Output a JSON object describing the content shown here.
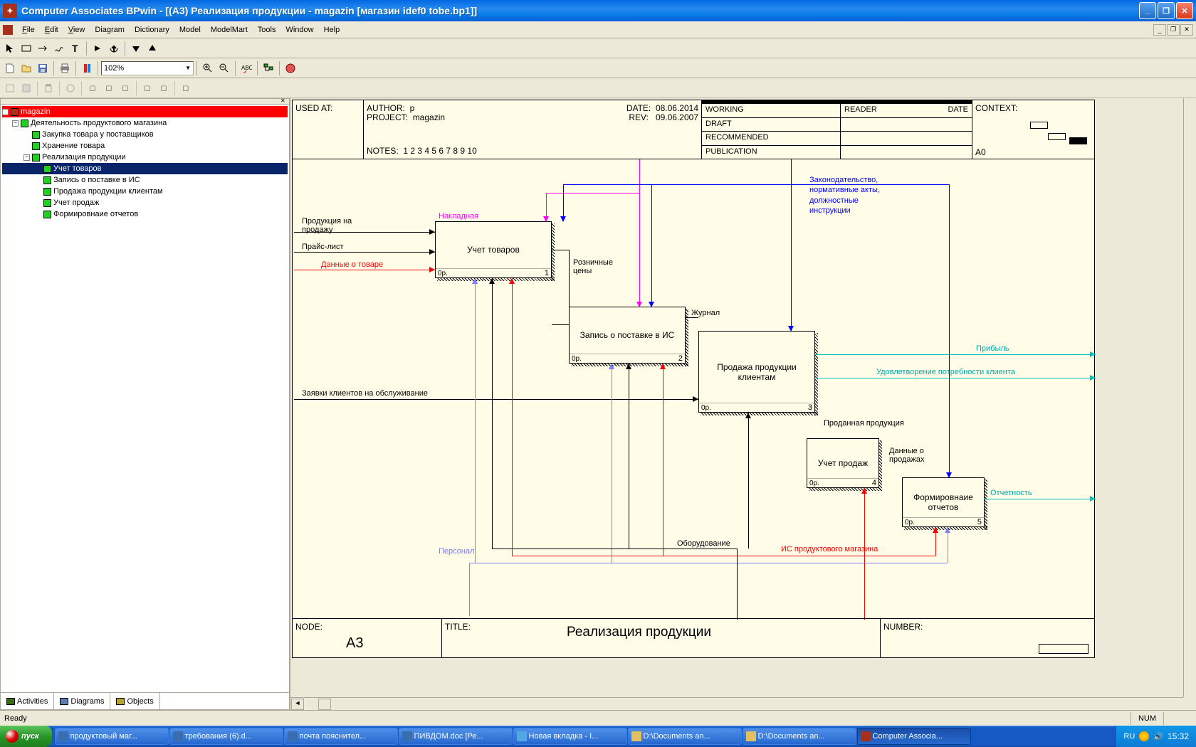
{
  "window": {
    "title": "Computer Associates BPwin - [(A3) Реализация   продукции - magazin  [магазин idef0 tobe.bp1]]"
  },
  "menu": {
    "file": "File",
    "edit": "Edit",
    "view": "View",
    "diagram": "Diagram",
    "dictionary": "Dictionary",
    "model": "Model",
    "modelmart": "ModelMart",
    "tools": "Tools",
    "window": "Window",
    "help": "Help"
  },
  "toolbar2": {
    "zoom": "102%"
  },
  "tree": {
    "root": "magazin",
    "n0": "Деятельность продуктового магазина",
    "n1": "Закупка товара  у поставщиков",
    "n2": "Хранение товара",
    "n3": "Реализация  продукции",
    "n3_1": "Учет товаров",
    "n3_2": "Запись о поставке в ИС",
    "n3_3": "Продажа продукции клиентам",
    "n3_4": "Учет продаж",
    "n3_5": "Формировнаие отчетов"
  },
  "explorer_tabs": {
    "activities": "Activities",
    "diagrams": "Diagrams",
    "objects": "Objects"
  },
  "header": {
    "used_at": "USED AT:",
    "author_lbl": "AUTHOR:",
    "author_val": "p",
    "project_lbl": "PROJECT:",
    "project_val": "magazin",
    "date_lbl": "DATE:",
    "date_val": "08.06.2014",
    "rev_lbl": "REV:",
    "rev_val": "09.06.2007",
    "notes_lbl": "NOTES:",
    "notes_val": "1  2  3  4  5  6  7  8  9  10",
    "working": "WORKING",
    "draft": "DRAFT",
    "recommended": "RECOMMENDED",
    "publication": "PUBLICATION",
    "reader": "READER",
    "reader_date": "DATE",
    "context": "CONTEXT:",
    "context_sub": "A0"
  },
  "footer": {
    "node_lbl": "NODE:",
    "node_val": "A3",
    "title_lbl": "TITLE:",
    "title_val": "Реализация   продукции",
    "number_lbl": "NUMBER:"
  },
  "boxes": {
    "b1": {
      "title": "Учет товаров",
      "op": "0р.",
      "num": "1"
    },
    "b2": {
      "title": "Запись о поставке в ИС",
      "op": "0р.",
      "num": "2"
    },
    "b3": {
      "title": "Продажа продукции клиентам",
      "op": "0р.",
      "num": "3"
    },
    "b4": {
      "title": "Учет продаж",
      "op": "0р.",
      "num": "4"
    },
    "b5": {
      "title": "Формировнаие отчетов",
      "op": "0р.",
      "num": "5"
    }
  },
  "arrows": {
    "a1": "Продукция на продажу",
    "a2": "Прайс-лист",
    "a3": "Данные о товаре",
    "a4": "Накладная",
    "a5": "Розничные цены",
    "a6": "Журнал",
    "a7": "Заявки клиентов на обслуживание",
    "a8": "Прибыль",
    "a9": "Удовлетворение потребности клиента",
    "a10": "Проданная продукция",
    "a11": "Данные о продажах",
    "a12": "Отчетность",
    "a13": "Персонал",
    "a14": "Оборудование",
    "a15": "ИС продуктового магазина",
    "a16_l1": "Законодательство,",
    "a16_l2": "нормативные акты,",
    "a16_l3": "должностные",
    "a16_l4": "инструкции"
  },
  "status": {
    "ready": "Ready",
    "num": "NUM"
  },
  "taskbar": {
    "start": "пуск",
    "lang": "RU",
    "time": "15:32",
    "items": [
      "продуктовый маг...",
      "требования (6).d...",
      "почта пояснител...",
      "ПИВДОМ.doc [Ре...",
      "Новая вкладка - I...",
      "D:\\Documents an...",
      "D:\\Documents an...",
      "Computer Associa..."
    ]
  }
}
